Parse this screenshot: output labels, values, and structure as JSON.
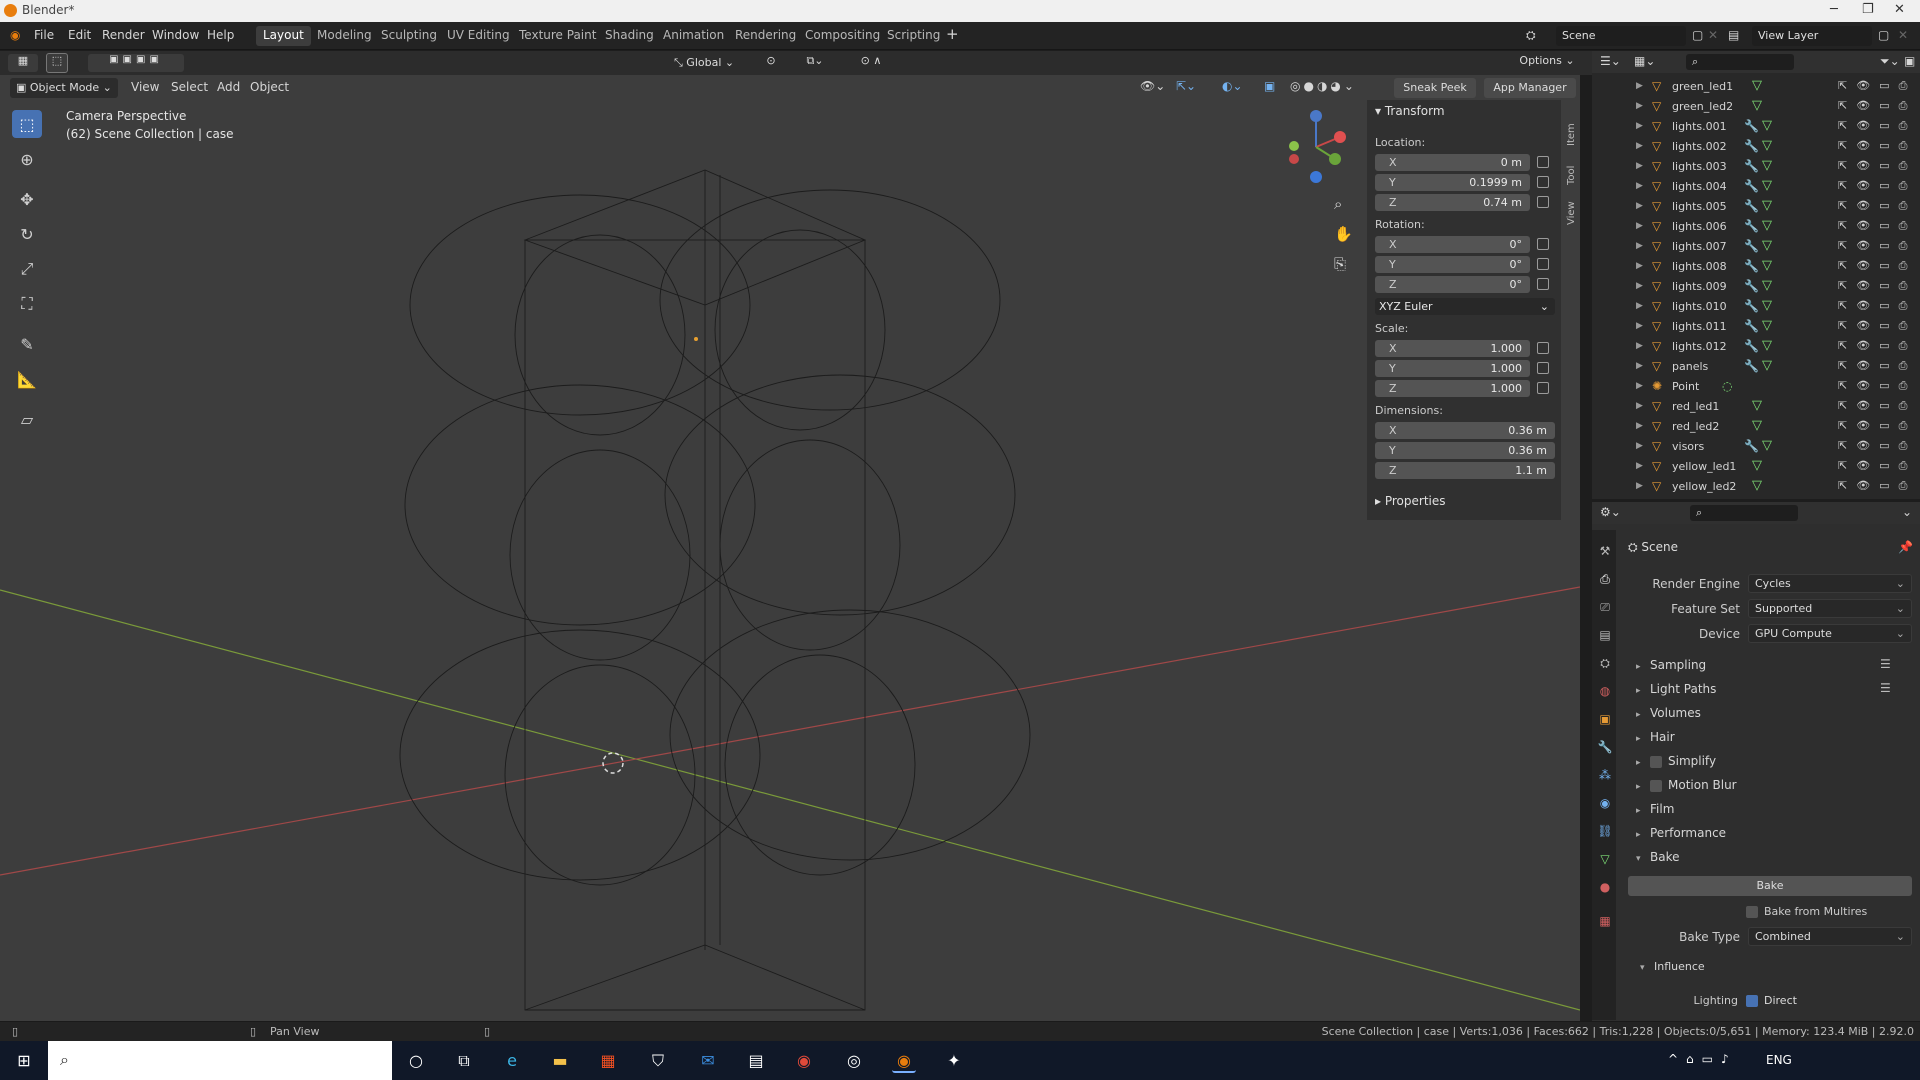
{
  "title": "Blender*",
  "menu": [
    "File",
    "Edit",
    "Render",
    "Window",
    "Help"
  ],
  "workspaces": [
    "Layout",
    "Modeling",
    "Sculpting",
    "UV Editing",
    "Texture Paint",
    "Shading",
    "Animation",
    "Rendering",
    "Compositing",
    "Scripting"
  ],
  "active_workspace": "Layout",
  "scene": "Scene",
  "view_layer": "View Layer",
  "viewport_header": {
    "mode": "Object Mode",
    "menus": [
      "View",
      "Select",
      "Add",
      "Object"
    ],
    "transform_orientation": "Global",
    "options": "Options",
    "sneak_peek": "Sneak Peek",
    "app_manager": "App Manager"
  },
  "viewport": {
    "line1": "Camera Perspective",
    "line2": "(62) Scene Collection | case"
  },
  "transform": {
    "title": "Transform",
    "location_label": "Location:",
    "location": [
      "0 m",
      "0.1999 m",
      "0.74 m"
    ],
    "rotation_label": "Rotation:",
    "rotation": [
      "0°",
      "0°",
      "0°"
    ],
    "rotation_mode": "XYZ Euler",
    "scale_label": "Scale:",
    "scale": [
      "1.000",
      "1.000",
      "1.000"
    ],
    "dimensions_label": "Dimensions:",
    "dimensions": [
      "0.36 m",
      "0.36 m",
      "1.1 m"
    ],
    "axes": [
      "X",
      "Y",
      "Z"
    ],
    "properties": "Properties"
  },
  "side_tabs": [
    "Item",
    "Tool",
    "View"
  ],
  "outliner": [
    {
      "name": "green_led1",
      "mod": false
    },
    {
      "name": "green_led2",
      "mod": false
    },
    {
      "name": "lights.001",
      "mod": true
    },
    {
      "name": "lights.002",
      "mod": true
    },
    {
      "name": "lights.003",
      "mod": true
    },
    {
      "name": "lights.004",
      "mod": true
    },
    {
      "name": "lights.005",
      "mod": true
    },
    {
      "name": "lights.006",
      "mod": true
    },
    {
      "name": "lights.007",
      "mod": true
    },
    {
      "name": "lights.008",
      "mod": true
    },
    {
      "name": "lights.009",
      "mod": true
    },
    {
      "name": "lights.010",
      "mod": true
    },
    {
      "name": "lights.011",
      "mod": true
    },
    {
      "name": "lights.012",
      "mod": true
    },
    {
      "name": "panels",
      "mod": true
    },
    {
      "name": "Point",
      "mod": false,
      "light": true
    },
    {
      "name": "red_led1",
      "mod": false
    },
    {
      "name": "red_led2",
      "mod": false
    },
    {
      "name": "visors",
      "mod": true
    },
    {
      "name": "yellow_led1",
      "mod": false
    },
    {
      "name": "yellow_led2",
      "mod": false
    }
  ],
  "properties": {
    "scene_name": "Scene",
    "render_engine_label": "Render Engine",
    "render_engine": "Cycles",
    "feature_set_label": "Feature Set",
    "feature_set": "Supported",
    "device_label": "Device",
    "device": "GPU Compute",
    "sections": [
      "Sampling",
      "Light Paths",
      "Volumes",
      "Hair",
      "Simplify",
      "Motion Blur",
      "Film",
      "Performance",
      "Bake"
    ],
    "bake_button": "Bake",
    "bake_from_multires": "Bake from Multires",
    "bake_type_label": "Bake Type",
    "bake_type": "Combined",
    "influence": "Influence",
    "lighting_label": "Lighting",
    "direct": "Direct"
  },
  "status": {
    "left": "Pan View",
    "right": "Scene Collection | case | Verts:1,036 | Faces:662 | Tris:1,228 | Objects:0/5,651 | Memory: 123.4 MiB | 2.92.0"
  },
  "taskbar": {
    "lang": "ENG"
  }
}
